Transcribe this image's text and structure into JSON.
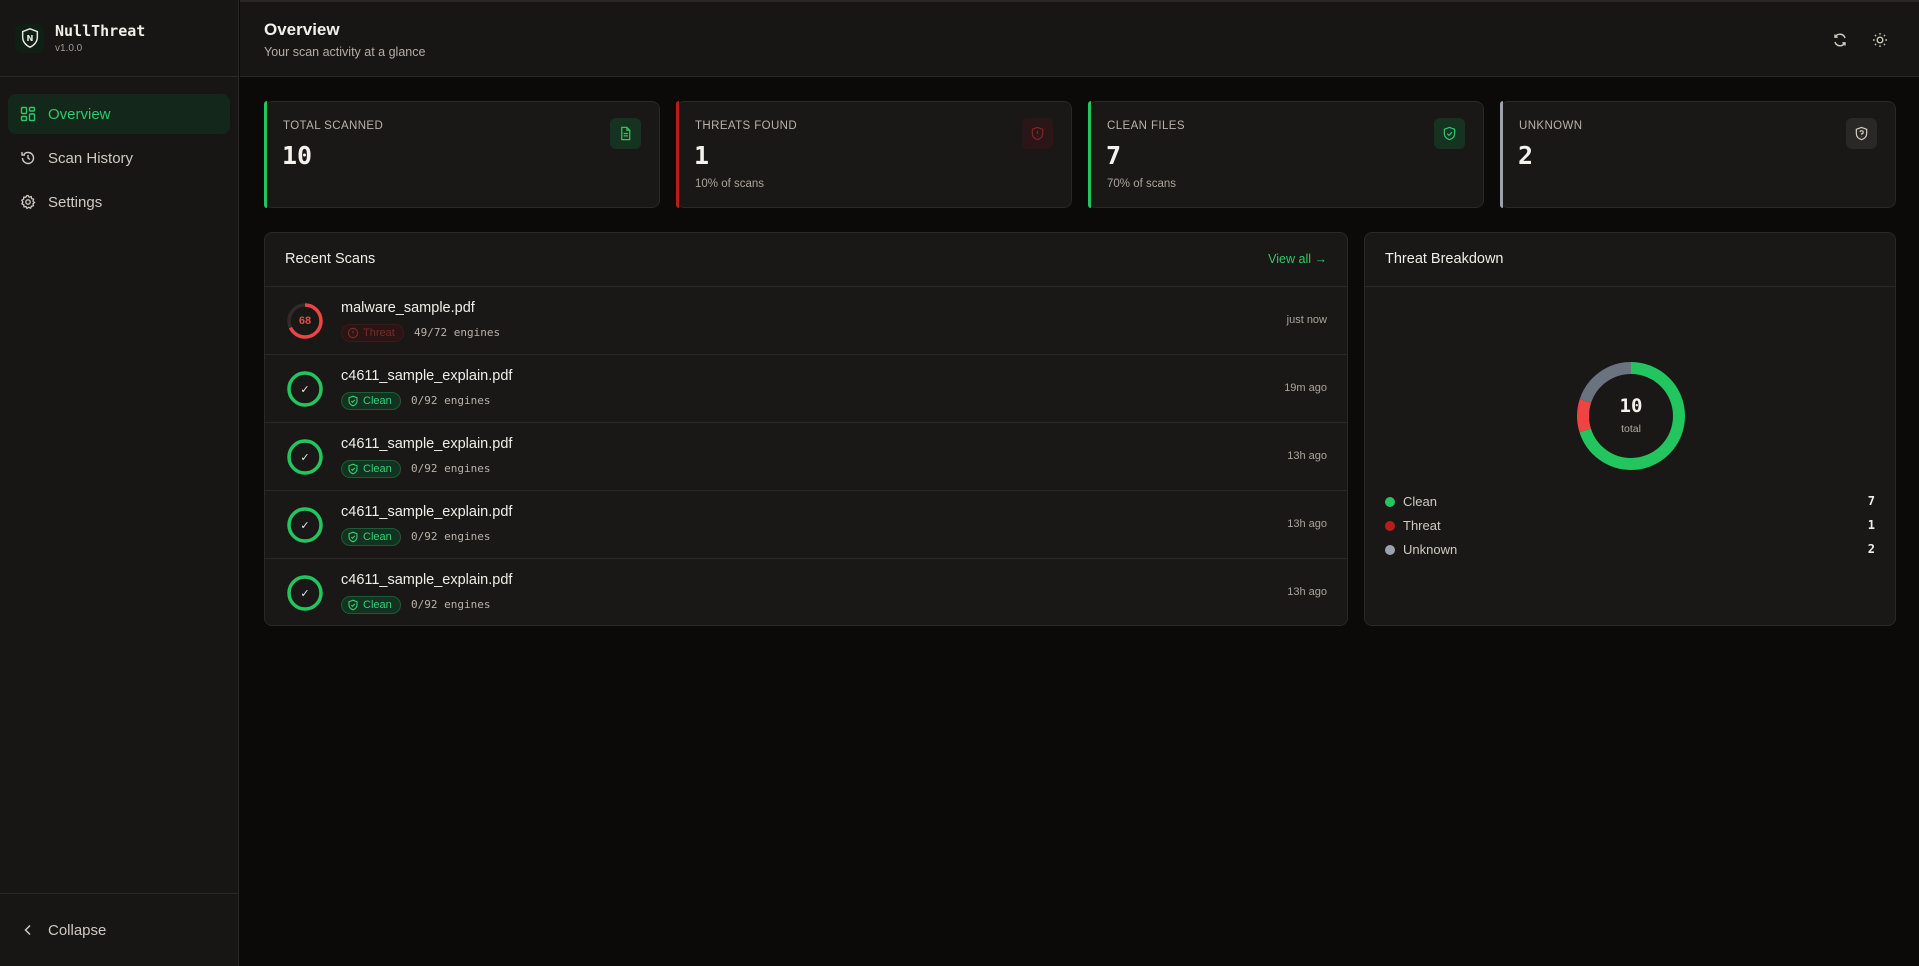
{
  "app": {
    "name": "NullThreat",
    "version": "v1.0.0"
  },
  "sidebar": {
    "items": [
      {
        "label": "Overview",
        "icon": "grid-icon",
        "active": true
      },
      {
        "label": "Scan History",
        "icon": "history-icon",
        "active": false
      },
      {
        "label": "Settings",
        "icon": "gear-icon",
        "active": false
      }
    ],
    "collapse_label": "Collapse"
  },
  "header": {
    "title": "Overview",
    "subtitle": "Your scan activity at a glance"
  },
  "stats": [
    {
      "label": "TOTAL SCANNED",
      "value": "10",
      "sub": "",
      "accent": "#22c55e",
      "icon": "file-icon"
    },
    {
      "label": "THREATS FOUND",
      "value": "1",
      "sub": "10% of scans",
      "accent": "#ef4444",
      "icon": "shield-alert-icon"
    },
    {
      "label": "CLEAN FILES",
      "value": "7",
      "sub": "70% of scans",
      "accent": "#22c55e",
      "icon": "shield-check-icon"
    },
    {
      "label": "UNKNOWN",
      "value": "2",
      "sub": "",
      "accent": "#9ca3af",
      "icon": "shield-question-icon"
    }
  ],
  "recent": {
    "title": "Recent Scans",
    "view_all": "View all →",
    "rows": [
      {
        "score": "68",
        "name": "malware_sample.pdf",
        "status": "Threat",
        "engines": "49/72 engines",
        "time": "just now",
        "fraction": 0.68
      },
      {
        "score": "✓",
        "name": "c4611_sample_explain.pdf",
        "status": "Clean",
        "engines": "0/92 engines",
        "time": "19m ago",
        "fraction": 1
      },
      {
        "score": "✓",
        "name": "c4611_sample_explain.pdf",
        "status": "Clean",
        "engines": "0/92 engines",
        "time": "13h ago",
        "fraction": 1
      },
      {
        "score": "✓",
        "name": "c4611_sample_explain.pdf",
        "status": "Clean",
        "engines": "0/92 engines",
        "time": "13h ago",
        "fraction": 1
      },
      {
        "score": "✓",
        "name": "c4611_sample_explain.pdf",
        "status": "Clean",
        "engines": "0/92 engines",
        "time": "13h ago",
        "fraction": 1
      }
    ]
  },
  "breakdown": {
    "title": "Threat Breakdown",
    "total": "10",
    "total_label": "total",
    "legend": [
      {
        "label": "Clean",
        "count": "7",
        "color": "#22c55e"
      },
      {
        "label": "Threat",
        "count": "1",
        "color": "#ef4444"
      },
      {
        "label": "Unknown",
        "count": "2",
        "color": "#9ca3af"
      }
    ]
  },
  "chart_data": {
    "type": "pie",
    "categories": [
      "Clean",
      "Threat",
      "Unknown"
    ],
    "values": [
      7,
      1,
      2
    ],
    "colors": [
      "#22c55e",
      "#ef4444",
      "#6b7280"
    ],
    "center_value": "10",
    "center_label": "total",
    "title": "Threat Breakdown"
  }
}
